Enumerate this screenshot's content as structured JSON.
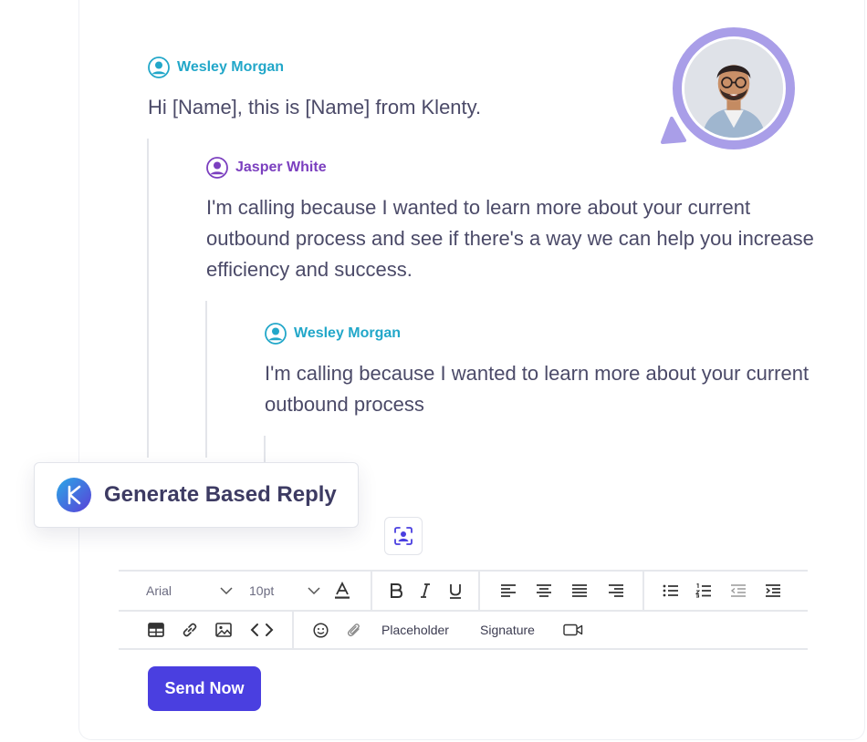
{
  "thread": [
    {
      "author": "Wesley Morgan",
      "text": "Hi [Name], this is [Name] from Klenty."
    },
    {
      "author": "Jasper White",
      "text": "I'm calling because I wanted to learn more about your current outbound process and see if there's a way we can help you increase efficiency and success."
    },
    {
      "author": "Wesley Morgan",
      "text": "I'm calling because I wanted to learn more about your current outbound process"
    }
  ],
  "generate_reply": {
    "label": "Generate Based Reply"
  },
  "toolbar": {
    "font_family": "Arial",
    "font_size": "10pt",
    "placeholder_label": "Placeholder",
    "signature_label": "Signature"
  },
  "send_button": {
    "label": "Send Now"
  },
  "colors": {
    "wesley": "#22a7c9",
    "jasper": "#7b3fbf",
    "accent": "#4a3fe0",
    "avatar_ring": "#a99ee8"
  }
}
